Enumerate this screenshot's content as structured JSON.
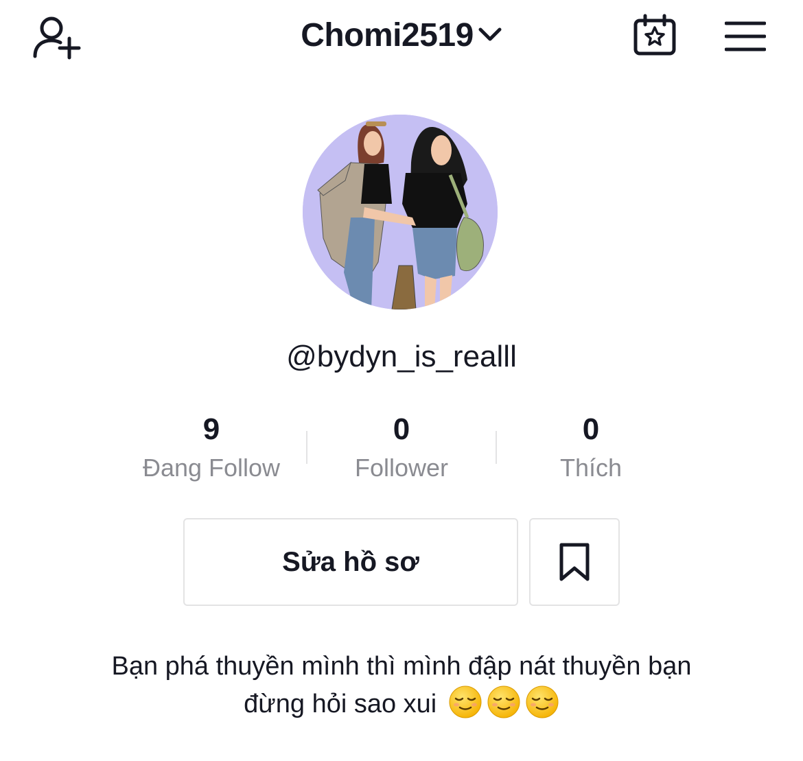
{
  "header": {
    "username": "Chomi2519",
    "icons": {
      "left": "add-friend-icon",
      "right_1": "calendar-star-icon",
      "right_2": "hamburger-menu-icon",
      "title_suffix": "chevron-down-icon"
    }
  },
  "profile": {
    "handle": "@bydyn_is_realll",
    "avatar_bg": "#c5bff3"
  },
  "stats": [
    {
      "value": "9",
      "label": "Đang Follow"
    },
    {
      "value": "0",
      "label": "Follower"
    },
    {
      "value": "0",
      "label": "Thích"
    }
  ],
  "actions": {
    "edit_label": "Sửa hồ sơ",
    "bookmark_icon": "bookmark-icon"
  },
  "bio": {
    "line1": "Bạn phá thuyền mình thì mình đập nát thuyền bạn",
    "line2": "đừng hỏi sao xui",
    "emojis": [
      "relieved-face-emoji",
      "relieved-face-emoji",
      "relieved-face-emoji"
    ]
  },
  "colors": {
    "text_primary": "#161823",
    "text_secondary": "#8a8b91",
    "border": "#e3e3e4"
  }
}
